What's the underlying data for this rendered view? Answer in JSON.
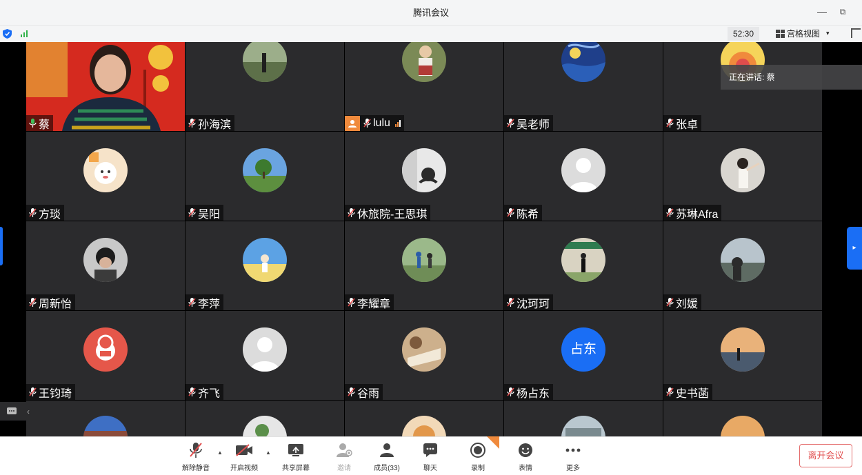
{
  "window": {
    "title": "腾讯会议",
    "minimize_label": "—",
    "restore_label": "⧉"
  },
  "infobar": {
    "timer": "52:30",
    "view_label": "宫格视图",
    "view_caret": "▾"
  },
  "speaking": {
    "text": "正在讲话: 蔡"
  },
  "participants": [
    {
      "name": "蔡",
      "mic": "active"
    },
    {
      "name": "孙海滨",
      "mic": "muted"
    },
    {
      "name": "lulu",
      "mic": "muted",
      "badge": "user",
      "signal": true
    },
    {
      "name": "吴老师",
      "mic": "muted"
    },
    {
      "name": "张卓",
      "mic": "muted"
    },
    {
      "name": "方琰",
      "mic": "muted"
    },
    {
      "name": "吴阳",
      "mic": "muted"
    },
    {
      "name": "休旅院-王思琪",
      "mic": "muted"
    },
    {
      "name": "陈希",
      "mic": "muted"
    },
    {
      "name": "苏琳Afra",
      "mic": "muted"
    },
    {
      "name": "周新怡",
      "mic": "muted"
    },
    {
      "name": "李萍",
      "mic": "muted"
    },
    {
      "name": "李耀章",
      "mic": "muted"
    },
    {
      "name": "沈珂珂",
      "mic": "muted"
    },
    {
      "name": "刘媛",
      "mic": "muted"
    },
    {
      "name": "王钧琦",
      "mic": "muted"
    },
    {
      "name": "齐飞",
      "mic": "muted"
    },
    {
      "name": "谷雨",
      "mic": "muted"
    },
    {
      "name": "杨占东",
      "mic": "muted",
      "initials": "占东"
    },
    {
      "name": "史书菡",
      "mic": "muted"
    }
  ],
  "toolbar": {
    "unmute": "解除静音",
    "start_video": "开启视频",
    "share_screen": "共享屏幕",
    "invite": "邀请",
    "members": "成员(33)",
    "chat": "聊天",
    "record": "录制",
    "reactions": "表情",
    "more": "更多",
    "leave": "离开会议",
    "caret": "▲"
  },
  "side": {
    "right_arrow": "▸",
    "left_arrow": "‹"
  },
  "colors": {
    "accent": "#1a6ef5",
    "tile_bg": "#2b2b2d",
    "danger": "#e14c4c",
    "orange": "#f08a3c"
  }
}
